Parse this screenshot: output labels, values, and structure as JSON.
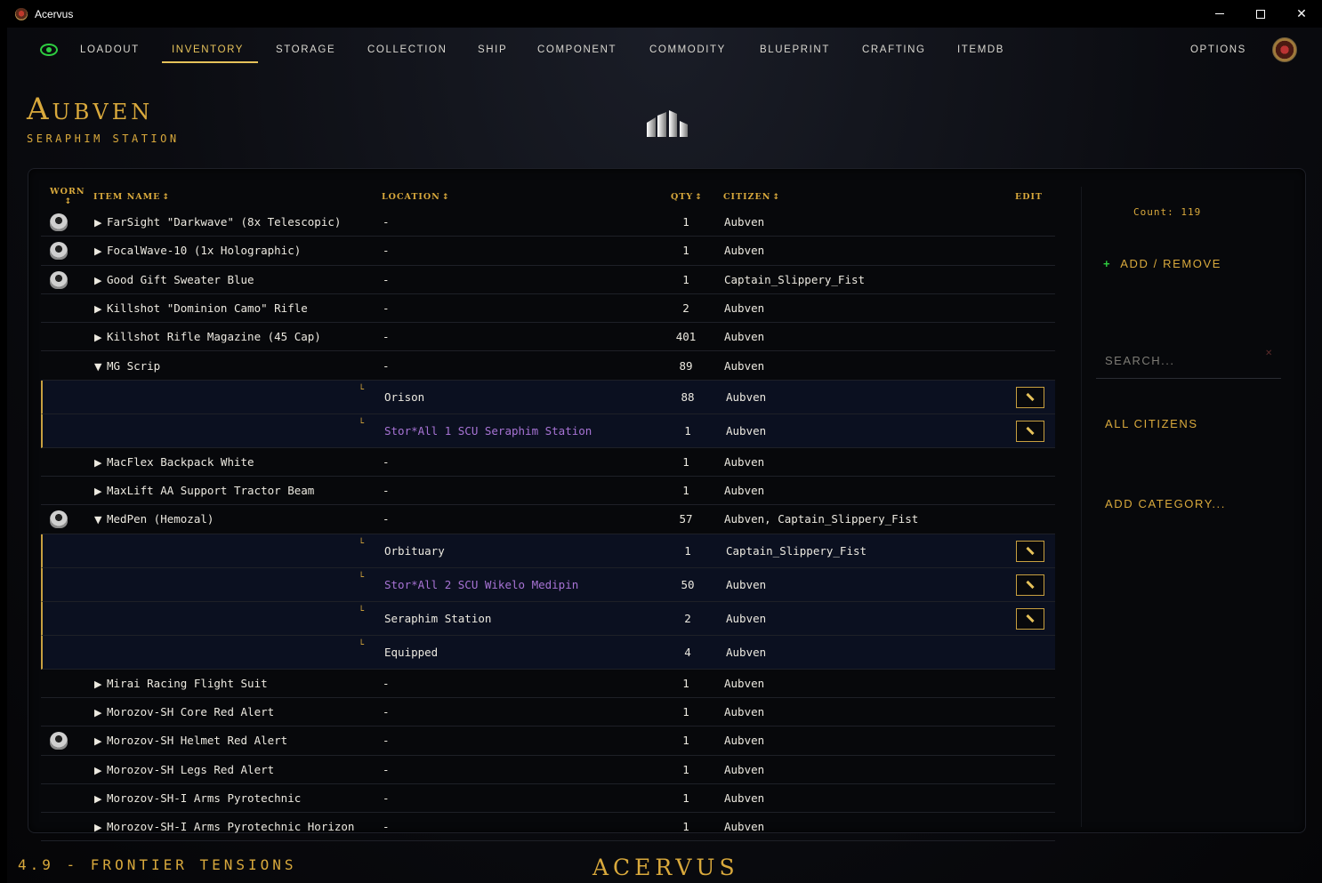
{
  "window": {
    "title": "Acervus",
    "close": "✕"
  },
  "nav": {
    "items": [
      "LOADOUT",
      "INVENTORY",
      "STORAGE",
      "COLLECTION",
      "SHIP",
      "COMPONENT",
      "COMMODITY",
      "BLUEPRINT",
      "CRAFTING",
      "ITEMDB"
    ],
    "active": "INVENTORY",
    "options": "OPTIONS"
  },
  "location": {
    "title": "Aubven",
    "subtitle": "SERAPHIM STATION"
  },
  "table": {
    "headers": {
      "worn": "WORN",
      "name": "ITEM NAME",
      "location": "LOCATION",
      "qty": "QTY",
      "citizen": "CITIZEN",
      "edit": "EDIT"
    },
    "sort_icon": "↕",
    "rows": [
      {
        "worn": true,
        "arrow": "▶",
        "name": "FarSight \"Darkwave\" (8x Telescopic)",
        "location": "-",
        "qty": "1",
        "citizen": "Aubven"
      },
      {
        "worn": true,
        "arrow": "▶",
        "name": "FocalWave-10 (1x Holographic)",
        "location": "-",
        "qty": "1",
        "citizen": "Aubven"
      },
      {
        "worn": true,
        "arrow": "▶",
        "name": "Good Gift Sweater Blue",
        "location": "-",
        "qty": "1",
        "citizen": "Captain_Slippery_Fist"
      },
      {
        "worn": false,
        "arrow": "▶",
        "name": "Killshot \"Dominion Camo\" Rifle",
        "location": "-",
        "qty": "2",
        "citizen": "Aubven"
      },
      {
        "worn": false,
        "arrow": "▶",
        "name": "Killshot Rifle Magazine (45 Cap)",
        "location": "-",
        "qty": "401",
        "citizen": "Aubven"
      },
      {
        "worn": false,
        "arrow": "▼",
        "name": "MG Scrip",
        "location": "-",
        "qty": "89",
        "citizen": "Aubven"
      },
      {
        "sub": true,
        "mark": "└",
        "location": "Orison",
        "qty": "88",
        "citizen": "Aubven",
        "edit": true,
        "purple": false
      },
      {
        "sub": true,
        "mark": "└",
        "location": "Stor*All 1 SCU Seraphim Station",
        "qty": "1",
        "citizen": "Aubven",
        "edit": true,
        "purple": true
      },
      {
        "worn": false,
        "arrow": "▶",
        "name": "MacFlex Backpack White",
        "location": "-",
        "qty": "1",
        "citizen": "Aubven"
      },
      {
        "worn": false,
        "arrow": "▶",
        "name": "MaxLift AA Support Tractor Beam",
        "location": "-",
        "qty": "1",
        "citizen": "Aubven"
      },
      {
        "worn": true,
        "arrow": "▼",
        "name": "MedPen (Hemozal)",
        "location": "-",
        "qty": "57",
        "citizen": "Aubven, Captain_Slippery_Fist"
      },
      {
        "sub": true,
        "mark": "└",
        "location": "Orbituary",
        "qty": "1",
        "citizen": "Captain_Slippery_Fist",
        "edit": true,
        "purple": false
      },
      {
        "sub": true,
        "mark": "└",
        "location": "Stor*All 2 SCU Wikelo Medipin",
        "qty": "50",
        "citizen": "Aubven",
        "edit": true,
        "purple": true
      },
      {
        "sub": true,
        "mark": "└",
        "location": "Seraphim Station",
        "qty": "2",
        "citizen": "Aubven",
        "edit": true,
        "purple": false
      },
      {
        "sub": true,
        "mark": "└",
        "location": "Equipped",
        "qty": "4",
        "citizen": "Aubven",
        "edit": false,
        "purple": false
      },
      {
        "worn": false,
        "arrow": "▶",
        "name": "Mirai Racing Flight Suit",
        "location": "-",
        "qty": "1",
        "citizen": "Aubven"
      },
      {
        "worn": false,
        "arrow": "▶",
        "name": "Morozov-SH Core Red Alert",
        "location": "-",
        "qty": "1",
        "citizen": "Aubven"
      },
      {
        "worn": true,
        "arrow": "▶",
        "name": "Morozov-SH Helmet Red Alert",
        "location": "-",
        "qty": "1",
        "citizen": "Aubven"
      },
      {
        "worn": false,
        "arrow": "▶",
        "name": "Morozov-SH Legs Red Alert",
        "location": "-",
        "qty": "1",
        "citizen": "Aubven"
      },
      {
        "worn": false,
        "arrow": "▶",
        "name": "Morozov-SH-I Arms Pyrotechnic",
        "location": "-",
        "qty": "1",
        "citizen": "Aubven"
      },
      {
        "worn": false,
        "arrow": "▶",
        "name": "Morozov-SH-I Arms Pyrotechnic Horizon",
        "location": "-",
        "qty": "1",
        "citizen": "Aubven"
      }
    ]
  },
  "sidebar": {
    "count": "Count: 119",
    "add_remove": "ADD / REMOVE",
    "add_icon": "+",
    "search_placeholder": "SEARCH...",
    "search_clear": "✕",
    "all_citizens": "ALL CITIZENS",
    "add_category": "ADD CATEGORY..."
  },
  "footer": {
    "version": "4.9 - FRONTIER TENSIONS",
    "logo": "ACERVUS"
  },
  "colors": {
    "accent": "#d9a93c",
    "active": "#e6c25a",
    "green": "#2ecc40",
    "purple": "#a773d4"
  },
  "icons": {
    "worn": "helmet-icon",
    "edit": "pencil-icon",
    "eye": "eye-icon",
    "stats": "bar-chart-icon"
  }
}
